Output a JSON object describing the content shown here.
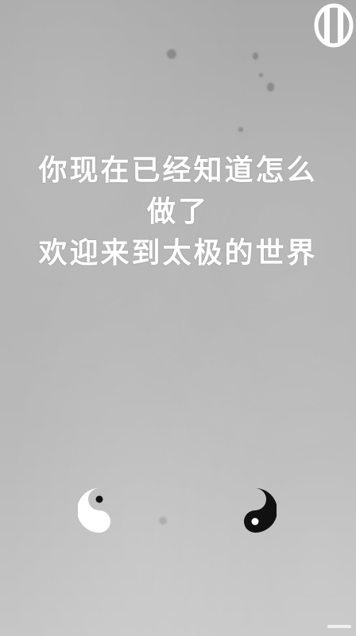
{
  "message": {
    "line1": "你现在已经知道怎么",
    "line2": "做了",
    "line3": "欢迎来到太极的世界"
  },
  "icons": {
    "pause": "pause-icon",
    "white_taiji": "white-taiji-icon",
    "black_taiji": "black-taiji-icon"
  },
  "colors": {
    "background": "#b4b4b4",
    "text": "#ffffff",
    "white_piece": "#ffffff",
    "black_piece": "#111111"
  }
}
